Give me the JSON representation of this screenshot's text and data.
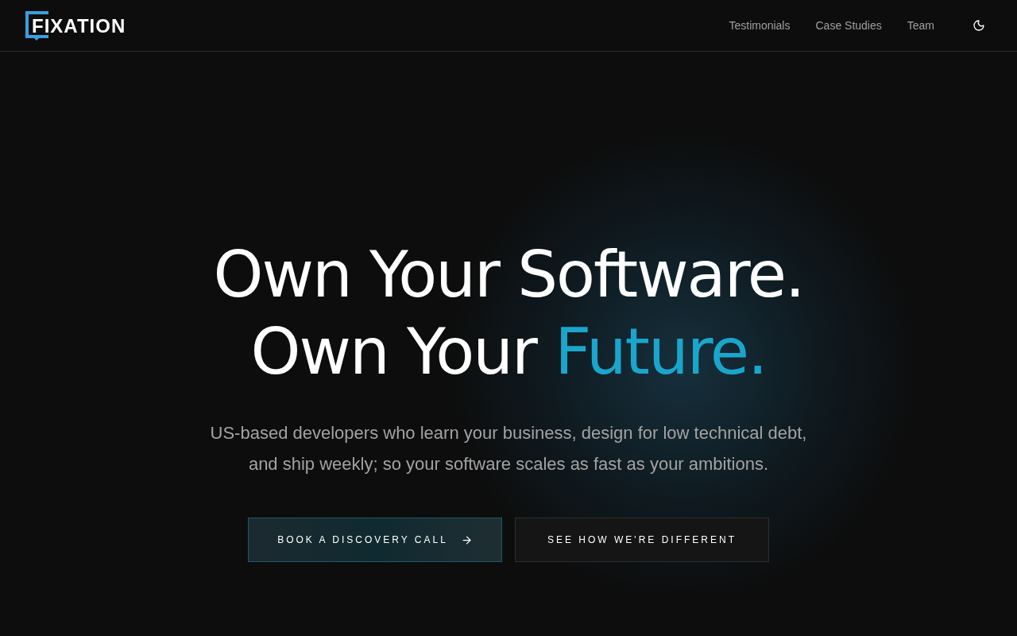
{
  "header": {
    "logo": "FIXATION",
    "nav": [
      {
        "label": "Testimonials"
      },
      {
        "label": "Case Studies"
      },
      {
        "label": "Team"
      }
    ]
  },
  "hero": {
    "headline_line_1": "Own Your Software.",
    "headline_line_2": "Own Your ",
    "headline_accent": "Future.",
    "subtitle": "US-based developers who learn your business, design for low technical debt, and ship weekly; so your software scales as fast as your ambitions.",
    "buttons": [
      {
        "kind": "primary",
        "label": "BOOK A DISCOVERY CALL"
      },
      {
        "kind": "secondary",
        "label": "SEE HOW WE'RE DIFFERENT"
      }
    ]
  }
}
